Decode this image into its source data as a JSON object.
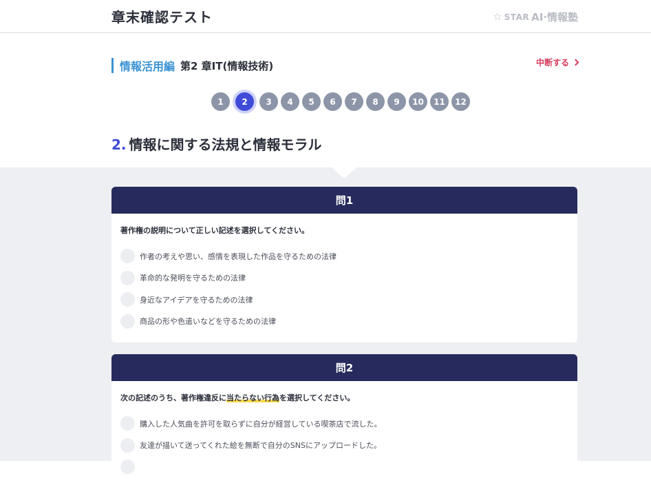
{
  "header": {
    "title": "章末確認テスト",
    "logo": {
      "star_text": "STAR",
      "brand": "AI·情報塾"
    }
  },
  "crumb": {
    "part": "情報活用編",
    "chapter": "第2 章IT(情報技術)"
  },
  "abort_label": "中断する",
  "pager": {
    "pages": [
      "1",
      "2",
      "3",
      "4",
      "5",
      "6",
      "7",
      "8",
      "9",
      "10",
      "11",
      "12"
    ],
    "active": "2"
  },
  "section": {
    "number": "2.",
    "title": "情報に関する法規と情報モラル"
  },
  "questions": [
    {
      "heading": "問1",
      "prompt": "著作権の説明について正しい記述を選択してください。",
      "options": [
        "作者の考えや思い、感情を表現した作品を守るための法律",
        "革命的な発明を守るための法律",
        "身近なアイデアを守るための法律",
        "商品の形や色遣いなどを守るための法律"
      ]
    },
    {
      "heading": "問2",
      "prompt_before": "次の記述のうち、著作権違反に",
      "prompt_highlight": "当たらない行為",
      "prompt_after": "を選択してください。",
      "options": [
        "購入した人気曲を許可を取らずに自分が経営している喫茶店で流した。",
        "友達が描いて送ってくれた絵を無断で自分のSNSにアップロードした。"
      ]
    }
  ],
  "colors": {
    "accent": "#3f4bd8",
    "crumb_blue": "#3b93d4",
    "card_head": "#262a5c",
    "abort_red": "#d63b5c",
    "highlight": "#f7d94c"
  }
}
